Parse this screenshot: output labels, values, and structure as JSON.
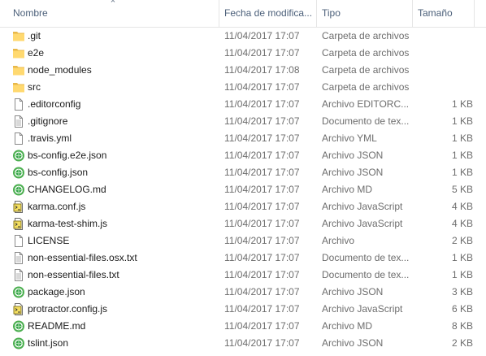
{
  "columns": {
    "name": "Nombre",
    "date": "Fecha de modifica...",
    "type": "Tipo",
    "size": "Tamaño"
  },
  "files": [
    {
      "name": ".git",
      "date": "11/04/2017 17:07",
      "type": "Carpeta de archivos",
      "size": "",
      "icon": "folder-icon"
    },
    {
      "name": "e2e",
      "date": "11/04/2017 17:07",
      "type": "Carpeta de archivos",
      "size": "",
      "icon": "folder-icon"
    },
    {
      "name": "node_modules",
      "date": "11/04/2017 17:08",
      "type": "Carpeta de archivos",
      "size": "",
      "icon": "folder-icon"
    },
    {
      "name": "src",
      "date": "11/04/2017 17:07",
      "type": "Carpeta de archivos",
      "size": "",
      "icon": "folder-icon"
    },
    {
      "name": ".editorconfig",
      "date": "11/04/2017 17:07",
      "type": "Archivo EDITORC...",
      "size": "1 KB",
      "icon": "blank-file-icon"
    },
    {
      "name": ".gitignore",
      "date": "11/04/2017 17:07",
      "type": "Documento de tex...",
      "size": "1 KB",
      "icon": "text-file-icon"
    },
    {
      "name": ".travis.yml",
      "date": "11/04/2017 17:07",
      "type": "Archivo YML",
      "size": "1 KB",
      "icon": "blank-file-icon"
    },
    {
      "name": "bs-config.e2e.json",
      "date": "11/04/2017 17:07",
      "type": "Archivo JSON",
      "size": "1 KB",
      "icon": "green-app-icon"
    },
    {
      "name": "bs-config.json",
      "date": "11/04/2017 17:07",
      "type": "Archivo JSON",
      "size": "1 KB",
      "icon": "green-app-icon"
    },
    {
      "name": "CHANGELOG.md",
      "date": "11/04/2017 17:07",
      "type": "Archivo MD",
      "size": "5 KB",
      "icon": "green-app-icon"
    },
    {
      "name": "karma.conf.js",
      "date": "11/04/2017 17:07",
      "type": "Archivo JavaScript",
      "size": "4 KB",
      "icon": "script-file-icon"
    },
    {
      "name": "karma-test-shim.js",
      "date": "11/04/2017 17:07",
      "type": "Archivo JavaScript",
      "size": "4 KB",
      "icon": "script-file-icon"
    },
    {
      "name": "LICENSE",
      "date": "11/04/2017 17:07",
      "type": "Archivo",
      "size": "2 KB",
      "icon": "blank-file-icon"
    },
    {
      "name": "non-essential-files.osx.txt",
      "date": "11/04/2017 17:07",
      "type": "Documento de tex...",
      "size": "1 KB",
      "icon": "text-file-icon"
    },
    {
      "name": "non-essential-files.txt",
      "date": "11/04/2017 17:07",
      "type": "Documento de tex...",
      "size": "1 KB",
      "icon": "text-file-icon"
    },
    {
      "name": "package.json",
      "date": "11/04/2017 17:07",
      "type": "Archivo JSON",
      "size": "3 KB",
      "icon": "green-app-icon"
    },
    {
      "name": "protractor.config.js",
      "date": "11/04/2017 17:07",
      "type": "Archivo JavaScript",
      "size": "6 KB",
      "icon": "script-file-icon"
    },
    {
      "name": "README.md",
      "date": "11/04/2017 17:07",
      "type": "Archivo MD",
      "size": "8 KB",
      "icon": "green-app-icon"
    },
    {
      "name": "tslint.json",
      "date": "11/04/2017 17:07",
      "type": "Archivo JSON",
      "size": "2 KB",
      "icon": "green-app-icon"
    }
  ]
}
